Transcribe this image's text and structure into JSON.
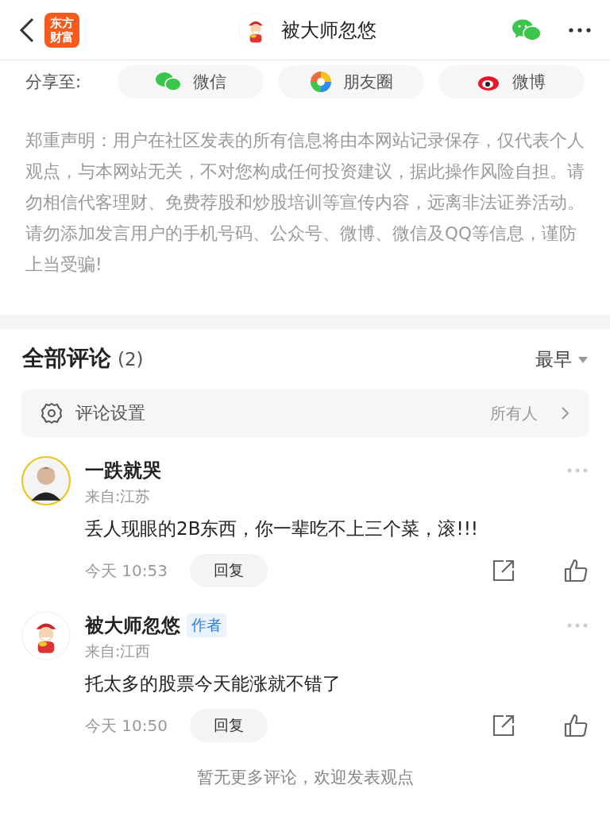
{
  "header": {
    "logo_lines": [
      "东方",
      "财富"
    ],
    "title": "被大师忽悠"
  },
  "share": {
    "label": "分享至:",
    "targets": [
      {
        "kind": "wechat",
        "label": "微信"
      },
      {
        "kind": "moments",
        "label": "朋友圈"
      },
      {
        "kind": "weibo",
        "label": "微博"
      }
    ]
  },
  "disclaimer": "郑重声明：用户在社区发表的所有信息将由本网站记录保存，仅代表个人观点，与本网站无关，不对您构成任何投资建议，据此操作风险自担。请勿相信代客理财、免费荐股和炒股培训等宣传内容，远离非法证券活动。请勿添加发言用户的手机号码、公众号、微博、微信及QQ等信息，谨防上当受骗!",
  "comments": {
    "title": "全部评论",
    "count": "(2)",
    "sort": "最早",
    "settings": {
      "label": "评论设置",
      "value": "所有人"
    },
    "items": [
      {
        "kind": "person",
        "name": "一跌就哭",
        "location": "来自:江苏",
        "text": "丢人现眼的2B东西，你一辈吃不上三个菜，滚!!!",
        "time": "今天 10:53",
        "reply": "回复"
      },
      {
        "kind": "mascot",
        "name": "被大师忽悠",
        "badge": "作者",
        "location": "来自:江西",
        "text": "托太多的股票今天能涨就不错了",
        "time": "今天 10:50",
        "reply": "回复"
      }
    ],
    "footer": "暂无更多评论，欢迎发表观点"
  }
}
